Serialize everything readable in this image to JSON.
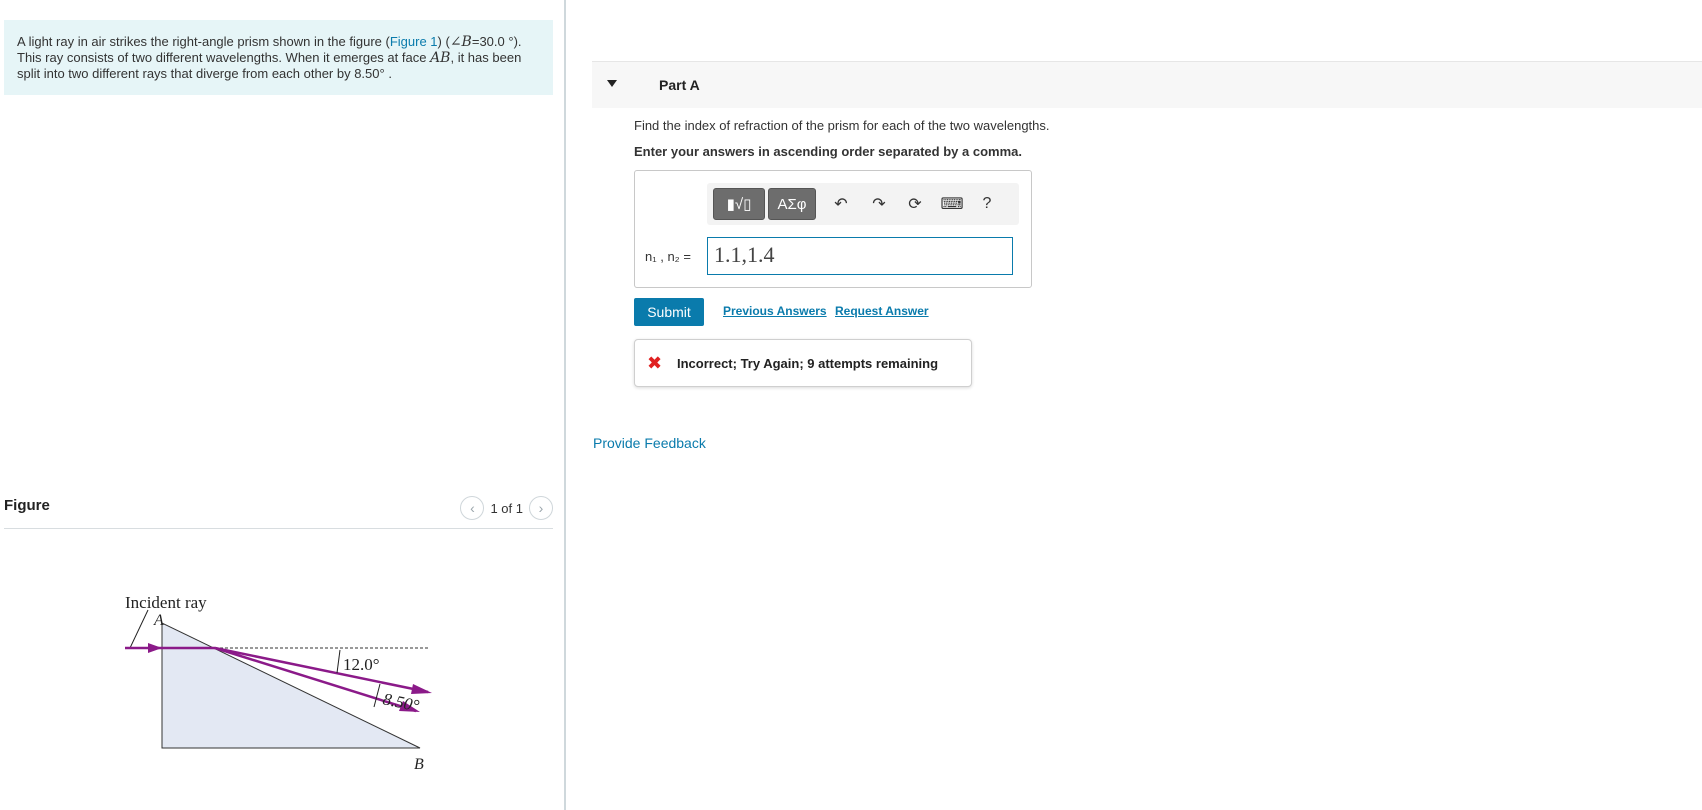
{
  "problem": {
    "text_1": "A light ray in air strikes the right-angle prism shown in the figure (",
    "figure_link": "Figure 1",
    "text_2": ") (",
    "angle_expr": "∠B",
    "angle_value": "=30.0 °",
    "text_3": ").",
    "text_4": "This ray consists of two different wavelengths. When it emerges at face ",
    "face": "AB",
    "text_5": ", it has been",
    "text_6": "split into two different rays that diverge from each other by 8.50° ."
  },
  "figure": {
    "title": "Figure",
    "pager": "1 of 1",
    "labels": {
      "incident_ray": "Incident ray",
      "a": "A",
      "b": "B",
      "angle_12": "12.0°",
      "angle_850": "8.50°"
    },
    "colors": {
      "ray": "#8b1a89",
      "prism_fill": "#e3e8f3"
    }
  },
  "part": {
    "title": "Part A",
    "question": "Find the index of refraction of the prism for each of the two wavelengths.",
    "instruction": "Enter your answers in ascending order separated by a comma.",
    "toolbar": {
      "templates_label": "▮√▯",
      "symbols_label": "ΑΣφ",
      "help_label": "?"
    },
    "input_label": "n₁ , n₂ =",
    "answer_value": "1.1,1.4",
    "submit_label": "Submit",
    "previous_answers": "Previous Answers",
    "request_answer": "Request Answer",
    "feedback": "Incorrect; Try Again; 9 attempts remaining"
  },
  "provide_feedback": "Provide Feedback",
  "colors": {
    "accent": "#0a7bac",
    "error": "#e02020",
    "problem_bg": "#e6f5f7"
  }
}
